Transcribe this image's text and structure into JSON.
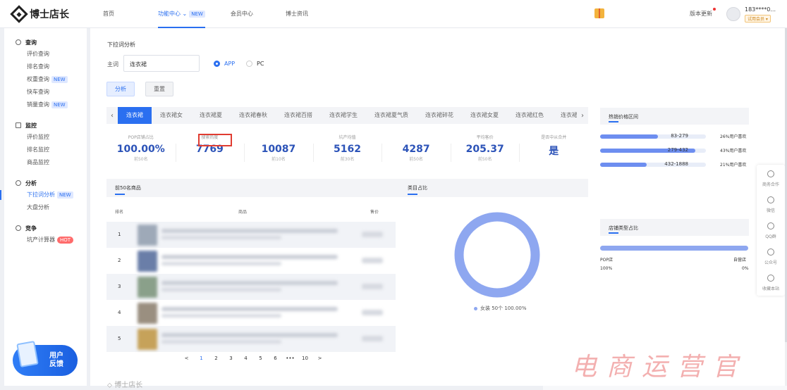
{
  "header": {
    "brand": "博士店长",
    "nav": [
      {
        "label": "首页"
      },
      {
        "label": "功能中心",
        "badge": "NEW"
      },
      {
        "label": "会员中心"
      },
      {
        "label": "博士资讯"
      }
    ],
    "version_label": "版本更新",
    "user_phone": "183****0...",
    "member_label": "试用会员 ▾"
  },
  "sidebar": {
    "groups": [
      {
        "title": "查询",
        "items": [
          {
            "label": "评价查询"
          },
          {
            "label": "排名查询"
          },
          {
            "label": "权重查询",
            "badge": "NEW"
          },
          {
            "label": "快车查询"
          },
          {
            "label": "销量查询",
            "badge": "NEW"
          }
        ]
      },
      {
        "title": "监控",
        "items": [
          {
            "label": "评价监控"
          },
          {
            "label": "排名监控"
          },
          {
            "label": "商品监控"
          }
        ]
      },
      {
        "title": "分析",
        "items": [
          {
            "label": "下拉词分析",
            "badge": "NEW"
          },
          {
            "label": "大盘分析"
          }
        ]
      },
      {
        "title": "竞争",
        "items": [
          {
            "label": "坑产计算器",
            "badge": "HOT"
          }
        ]
      }
    ],
    "feedback_line1": "用户",
    "feedback_line2": "反馈"
  },
  "main": {
    "title": "下拉词分析",
    "keyword_label": "主词",
    "keyword_value": "连衣裙",
    "radio_app": "APP",
    "radio_pc": "PC",
    "analyze_button": "分析",
    "reset_button": "重置",
    "tabs": [
      "连衣裙",
      "连衣裙女",
      "连衣裙夏",
      "连衣裙春秋",
      "连衣裙百搭",
      "连衣裙学生",
      "连衣裙夏气质",
      "连衣裙碎花",
      "连衣裙女夏",
      "连衣裙红色",
      "连衣裙..."
    ],
    "metrics": [
      {
        "label": "POP店铺占比",
        "value": "100.00%",
        "sub": "前50名"
      },
      {
        "label": "搜索热度",
        "value": "7769",
        "sub": ""
      },
      {
        "label": "",
        "value": "10087",
        "sub": "前10名"
      },
      {
        "label": "坑产均值",
        "value": "5162",
        "sub": "前30名"
      },
      {
        "label": "",
        "value": "4287",
        "sub": "前50名"
      },
      {
        "label": "平均客价",
        "value": "205.37",
        "sub": "前50名"
      },
      {
        "label": "是否中从合并",
        "value": "是",
        "sub": ""
      }
    ],
    "products_title": "前50名商品",
    "category_title": "类目占比",
    "columns": {
      "rank": "排名",
      "product": "商品",
      "price": "售价"
    },
    "rows": [
      {
        "rank": "1",
        "color": "#9ea9b8"
      },
      {
        "rank": "2",
        "color": "#6a7ea8"
      },
      {
        "rank": "3",
        "color": "#8aa08a"
      },
      {
        "rank": "4",
        "color": "#9a8f80"
      },
      {
        "rank": "5",
        "color": "#c6a25a"
      }
    ],
    "pagination": [
      "<",
      "1",
      "2",
      "3",
      "4",
      "5",
      "6",
      "•••",
      "10",
      ">"
    ],
    "donut_legend": "女装 50个 100.00%",
    "footer_brand": "博士店长"
  },
  "right": {
    "price_title": "热销价格区间",
    "price_rows": [
      {
        "range": "83-279",
        "share": "26%用户喜欢",
        "fill": 0.26
      },
      {
        "range": "279-432",
        "share": "43%用户喜欢",
        "fill": 0.43
      },
      {
        "range": "432-1888",
        "share": "21%用户喜欢",
        "fill": 0.21
      }
    ],
    "shop_title": "店铺类型占比",
    "shop_left": "POP店",
    "shop_right": "自营店",
    "shop_left_pct": "100%",
    "shop_right_pct": "0%"
  },
  "float_bar": [
    {
      "label": "商务合作",
      "icon": "handshake-icon"
    },
    {
      "label": "微信",
      "icon": "wechat-icon"
    },
    {
      "label": "QQ群",
      "icon": "qq-icon"
    },
    {
      "label": "公众号",
      "icon": "chat-icon"
    },
    {
      "label": "收藏本站",
      "icon": "star-icon"
    }
  ],
  "watermark": "电商运营官",
  "chart_data": {
    "type": "pie",
    "title": "类目占比",
    "categories": [
      "女装"
    ],
    "values": [
      100
    ],
    "labels": [
      "女装 50个 100.00%"
    ]
  },
  "colors": {
    "accent": "#2a6ff0",
    "metric": "#2c53b8",
    "donut": "#8ea7f0"
  }
}
